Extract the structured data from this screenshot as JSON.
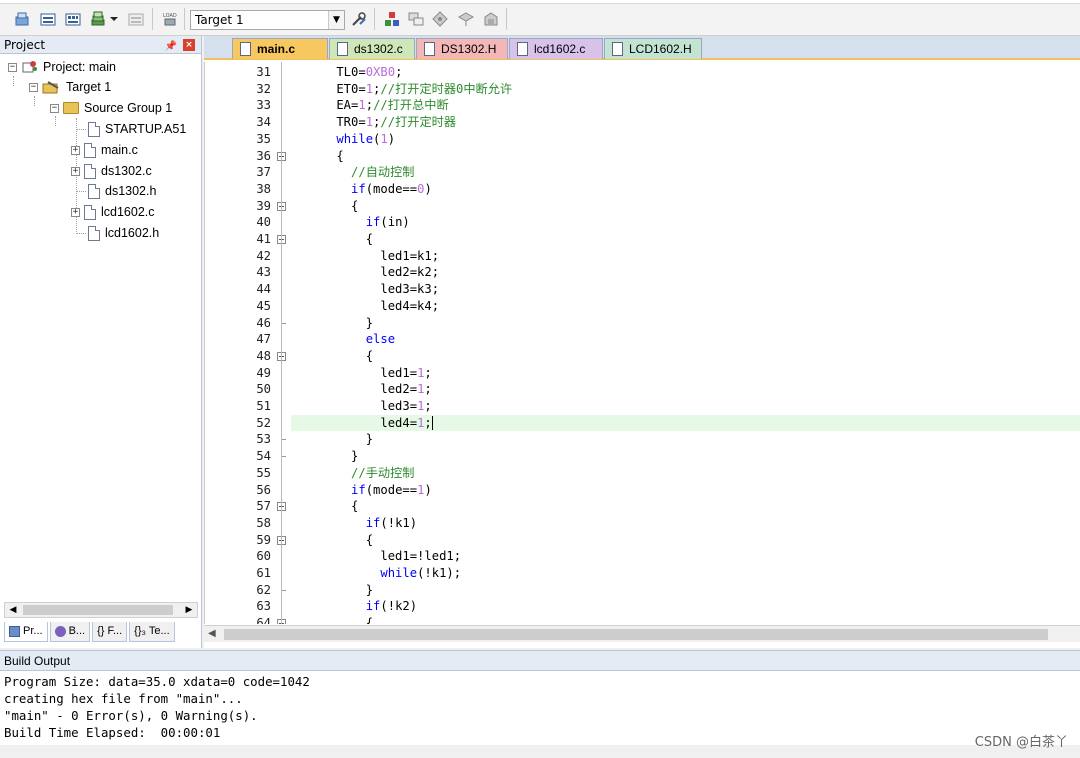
{
  "toolbar": {
    "target_value": "Target 1",
    "icons": [
      "translate-icon",
      "build-icon",
      "rebuild-icon",
      "batch-build-icon",
      "stop-build-icon",
      "download-icon",
      "target-options-icon",
      "manage-components-icon",
      "file-extensions-icon",
      "environment-icon",
      "packs-icon",
      "select-packs-icon"
    ]
  },
  "project": {
    "title": "Project",
    "tree": {
      "root": "Project: main",
      "target": "Target 1",
      "group": "Source Group 1",
      "files": [
        "STARTUP.A51",
        "main.c",
        "ds1302.c",
        "ds1302.h",
        "lcd1602.c",
        "lcd1602.h"
      ]
    },
    "tabs": [
      "Pr...",
      "B...",
      "{} F...",
      "{}₃ Te..."
    ]
  },
  "editor": {
    "tabs": [
      {
        "label": "main.c",
        "color": "#f6c85f"
      },
      {
        "label": "ds1302.c",
        "color": "#cfe6b8"
      },
      {
        "label": "DS1302.H",
        "color": "#f4b7b7"
      },
      {
        "label": "lcd1602.c",
        "color": "#d9c2ea"
      },
      {
        "label": "LCD1602.H",
        "color": "#c3e3d3"
      }
    ],
    "highlight_line": 52,
    "lines": [
      {
        "n": "31",
        "t": "    TL0=0XB0;"
      },
      {
        "n": "32",
        "t": "    ET0=1;//打开定时器0中断允许"
      },
      {
        "n": "33",
        "t": "    EA=1;//打开总中断"
      },
      {
        "n": "34",
        "t": "    TR0=1;//打开定时器"
      },
      {
        "n": "35",
        "t": "    while(1)"
      },
      {
        "n": "36",
        "t": "    {"
      },
      {
        "n": "37",
        "t": "      //自动控制"
      },
      {
        "n": "38",
        "t": "      if(mode==0)"
      },
      {
        "n": "39",
        "t": "      {"
      },
      {
        "n": "40",
        "t": "        if(in)"
      },
      {
        "n": "41",
        "t": "        {"
      },
      {
        "n": "42",
        "t": "          led1=k1;"
      },
      {
        "n": "43",
        "t": "          led2=k2;"
      },
      {
        "n": "44",
        "t": "          led3=k3;"
      },
      {
        "n": "45",
        "t": "          led4=k4;"
      },
      {
        "n": "46",
        "t": "        }"
      },
      {
        "n": "47",
        "t": "        else"
      },
      {
        "n": "48",
        "t": "        {"
      },
      {
        "n": "49",
        "t": "          led1=1;"
      },
      {
        "n": "50",
        "t": "          led2=1;"
      },
      {
        "n": "51",
        "t": "          led3=1;"
      },
      {
        "n": "52",
        "t": "          led4=1;"
      },
      {
        "n": "53",
        "t": "        }"
      },
      {
        "n": "54",
        "t": "      }"
      },
      {
        "n": "55",
        "t": "      //手动控制"
      },
      {
        "n": "56",
        "t": "      if(mode==1)"
      },
      {
        "n": "57",
        "t": "      {"
      },
      {
        "n": "58",
        "t": "        if(!k1)"
      },
      {
        "n": "59",
        "t": "        {"
      },
      {
        "n": "60",
        "t": "          led1=!led1;"
      },
      {
        "n": "61",
        "t": "          while(!k1);"
      },
      {
        "n": "62",
        "t": "        }"
      },
      {
        "n": "63",
        "t": "        if(!k2)"
      },
      {
        "n": "64",
        "t": "        {"
      }
    ]
  },
  "build_output": {
    "title": "Build Output",
    "lines": [
      "Program Size: data=35.0 xdata=0 code=1042",
      "creating hex file from \"main\"...",
      "\"main\" - 0 Error(s), 0 Warning(s).",
      "Build Time Elapsed:  00:00:01"
    ]
  },
  "watermark": "CSDN @白茶丫"
}
